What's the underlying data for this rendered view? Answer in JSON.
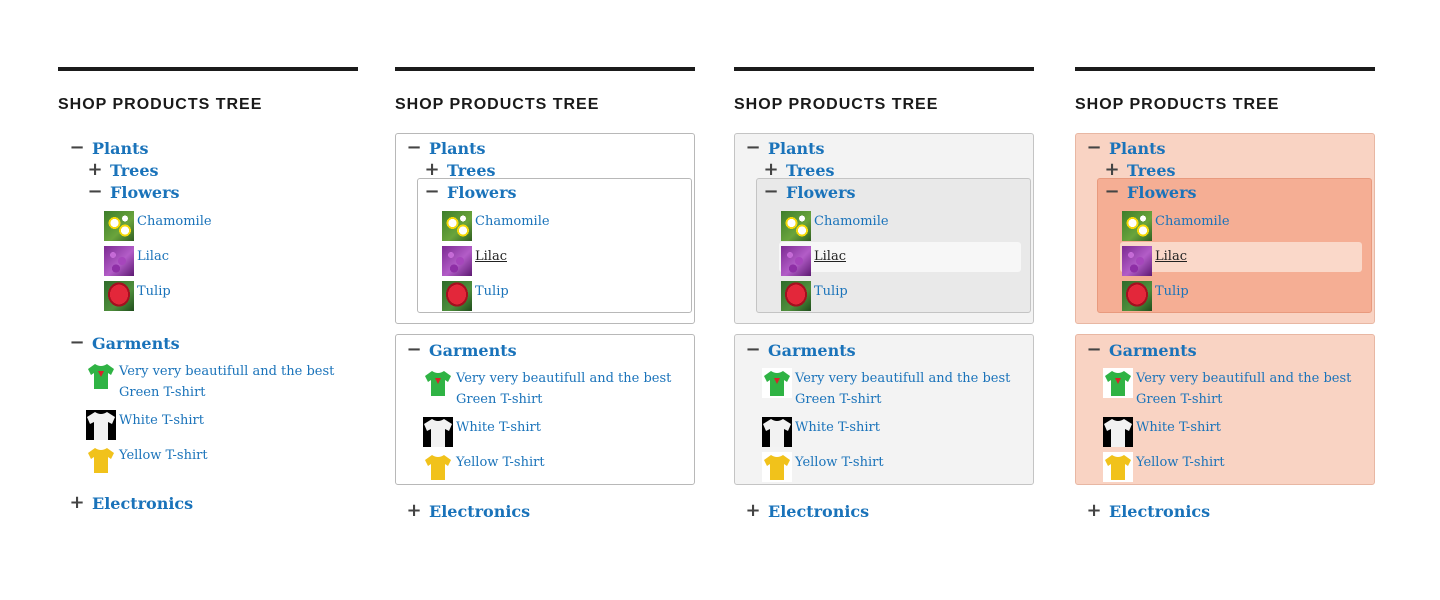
{
  "title": "SHOP PRODUCTS TREE",
  "colors": {
    "link": "#1a73ba",
    "rule": "#1b1b1b",
    "panel3_bg": "#f3f3f3",
    "panel3_inner": "#eaeaea",
    "panel4_bg": "#f8d2c2",
    "panel4_inner": "#f5ad93"
  },
  "tree": {
    "plants": "Plants",
    "trees": "Trees",
    "flowers": "Flowers",
    "chamomile": "Chamomile",
    "lilac": "Lilac",
    "tulip": "Tulip",
    "garments": "Garments",
    "green_tshirt_line1": "Very very beautifull and the best Green",
    "green_tshirt_line2": "T-shirt",
    "white_tshirt": "White T-shirt",
    "yellow_tshirt": "Yellow T-shirt",
    "electronics": "Electronics"
  },
  "icons": {
    "expanded": "−",
    "collapsed": "+"
  }
}
